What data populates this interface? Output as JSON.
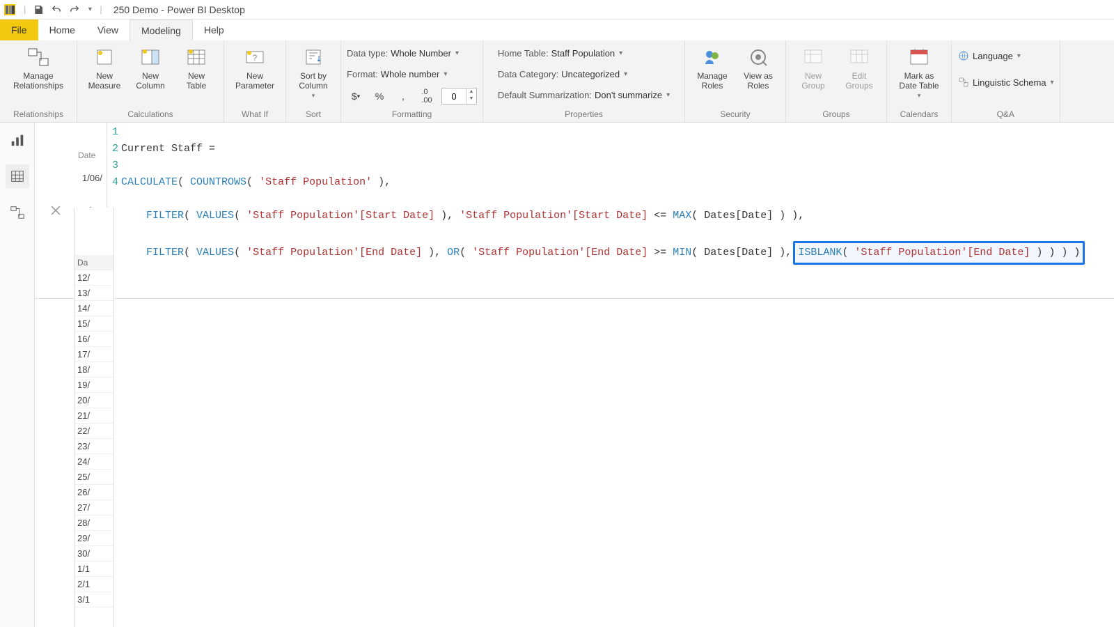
{
  "titlebar": {
    "title": "250 Demo - Power BI Desktop"
  },
  "tabs": {
    "file": "File",
    "home": "Home",
    "view": "View",
    "modeling": "Modeling",
    "help": "Help",
    "active": "Modeling"
  },
  "ribbon": {
    "relationships": {
      "label": "Relationships",
      "manage": "Manage\nRelationships"
    },
    "calculations": {
      "label": "Calculations",
      "new_measure": "New\nMeasure",
      "new_column": "New\nColumn",
      "new_table": "New\nTable"
    },
    "whatif": {
      "label": "What If",
      "new_parameter": "New\nParameter"
    },
    "sort": {
      "label": "Sort",
      "sort_by_column": "Sort by\nColumn"
    },
    "formatting": {
      "label": "Formatting",
      "data_type_label": "Data type:",
      "data_type_value": "Whole Number",
      "format_label": "Format:",
      "format_value": "Whole number",
      "decimals": "0"
    },
    "properties": {
      "label": "Properties",
      "home_table_label": "Home Table:",
      "home_table_value": "Staff Population",
      "data_category_label": "Data Category:",
      "data_category_value": "Uncategorized",
      "default_summarization_label": "Default Summarization:",
      "default_summarization_value": "Don't summarize"
    },
    "security": {
      "label": "Security",
      "manage_roles": "Manage\nRoles",
      "view_as_roles": "View as\nRoles"
    },
    "groups": {
      "label": "Groups",
      "new_group": "New\nGroup",
      "edit_groups": "Edit\nGroups"
    },
    "calendars": {
      "label": "Calendars",
      "mark_as_date_table": "Mark as\nDate Table"
    },
    "qa": {
      "label": "Q&A",
      "language": "Language",
      "linguistic_schema": "Linguistic Schema"
    }
  },
  "formula": {
    "gutter": [
      "1",
      "2",
      "3",
      "4"
    ],
    "line1_plain": "Current Staff =",
    "line2": {
      "calc": "CALCULATE",
      "p1": "( ",
      "count": "COUNTROWS",
      "p2": "( ",
      "tbl": "'Staff Population'",
      "p3": " ),"
    },
    "line3": {
      "indent": "    ",
      "filter": "FILTER",
      "p1": "( ",
      "values": "VALUES",
      "p2": "( ",
      "col1": "'Staff Population'[Start Date]",
      "p3": " ), ",
      "col2": "'Staff Population'[Start Date]",
      "op": " <= ",
      "max": "MAX",
      "p4": "( ",
      "dates": "Dates[Date]",
      "p5": " ) ),"
    },
    "line4": {
      "indent": "    ",
      "filter": "FILTER",
      "p1": "( ",
      "values": "VALUES",
      "p2": "( ",
      "col1": "'Staff Population'[End Date]",
      "p3": " ), ",
      "or": "OR",
      "p4": "( ",
      "col2": "'Staff Population'[End Date]",
      "op": " >= ",
      "min": "MIN",
      "p5": "( ",
      "dates": "Dates[Date]",
      "p6": " ),",
      "hl_isblank": "ISBLANK",
      "hl_p1": "( ",
      "hl_col": "'Staff Population'[End Date]",
      "hl_p2": " ) ) ) )"
    }
  },
  "grid": {
    "peek_hdr": "Date",
    "peek_val": "1/06/",
    "col_hdr": "Da",
    "rows": [
      "12/",
      "13/",
      "14/",
      "15/",
      "16/",
      "17/",
      "18/",
      "19/",
      "20/",
      "21/",
      "22/",
      "23/",
      "24/",
      "25/",
      "26/",
      "27/",
      "28/",
      "29/",
      "30/",
      "1/1",
      "2/1",
      "3/1"
    ]
  }
}
